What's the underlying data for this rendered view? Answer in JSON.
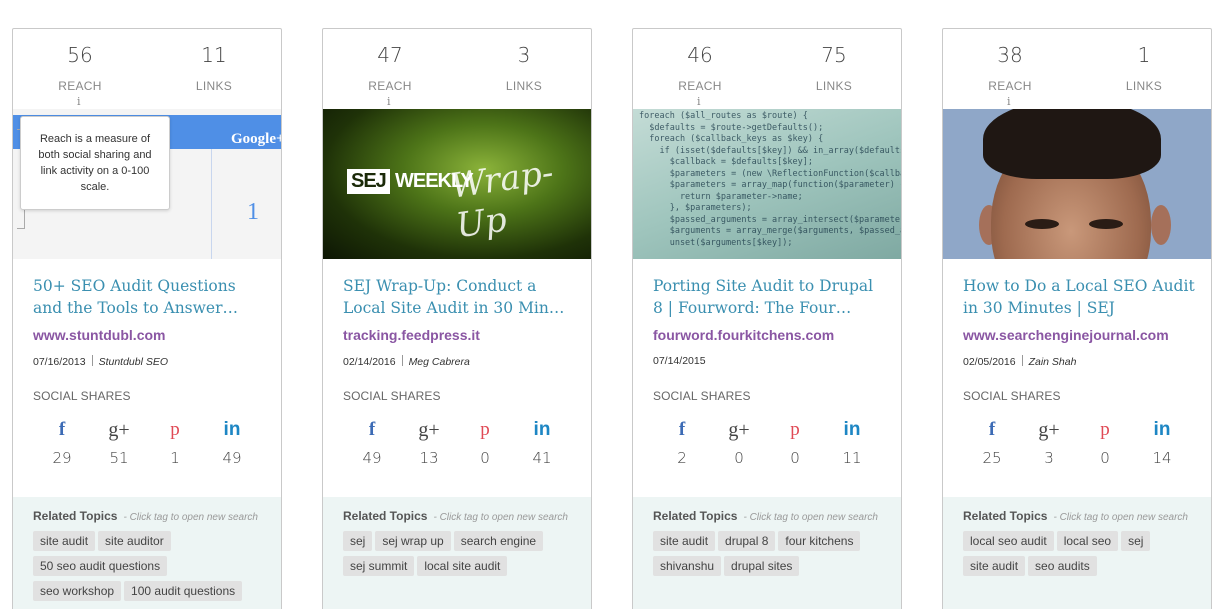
{
  "labels": {
    "reach": "REACH",
    "links": "LINKS",
    "social_shares": "SOCIAL SHARES",
    "related_topics": "Related Topics",
    "related_hint": "- Click tag to open new search",
    "info_icon": "i",
    "tooltip": "Reach is a measure of both social sharing and link activity on a 0-100 scale."
  },
  "thumb_text": {
    "google": "Google",
    "gplus": "+",
    "one": "1",
    "sej": "SEJ",
    "weekly": "WEEKLY",
    "wrap": "Wrap-Up",
    "code": "foreach ($all_routes as $route) {\n  $defaults = $route->getDefaults();\n  foreach ($callback_keys as $key) {\n    if (isset($defaults[$key]) && in_array($defaults\n      $callback = $defaults[$key];\n      $parameters = (new \\ReflectionFunction($callback\n      $parameters = array_map(function($parameter) {\n        return $parameter->name;\n      }, $parameters);\n      $passed_arguments = array_intersect($parameters, $a\n      $arguments = array_merge($arguments, $passed_arg\n      unset($arguments[$key]);"
  },
  "icons": {
    "facebook": "f",
    "googleplus": "g+",
    "pinterest": "p",
    "linkedin": "in"
  },
  "colors": {
    "title": "#3a8fb0",
    "domain": "#8a56a3",
    "facebook": "#3c6bb5",
    "pinterest": "#e04a55",
    "linkedin": "#1d86c4",
    "related_bg": "#edf5f4"
  },
  "cards": [
    {
      "reach": "56",
      "links": "11",
      "title": "50+ SEO Audit Questions and the Tools to Answer…",
      "domain": "www.stuntdubl.com",
      "date": "07/16/2013",
      "author": "Stuntdubl SEO",
      "shares": {
        "facebook": "29",
        "googleplus": "51",
        "pinterest": "1",
        "linkedin": "49"
      },
      "tags": [
        "site audit",
        "site auditor",
        "50 seo audit questions",
        "seo workshop",
        "100 audit questions"
      ]
    },
    {
      "reach": "47",
      "links": "3",
      "title": "SEJ Wrap-Up: Conduct a Local Site Audit in 30 Min…",
      "domain": "tracking.feedpress.it",
      "date": "02/14/2016",
      "author": "Meg Cabrera",
      "shares": {
        "facebook": "49",
        "googleplus": "13",
        "pinterest": "0",
        "linkedin": "41"
      },
      "tags": [
        "sej",
        "sej wrap up",
        "search engine",
        "sej summit",
        "local site audit"
      ]
    },
    {
      "reach": "46",
      "links": "75",
      "title": "Porting Site Audit to Drupal 8 | Fourword: The Four…",
      "domain": "fourword.fourkitchens.com",
      "date": "07/14/2015",
      "author": "",
      "shares": {
        "facebook": "2",
        "googleplus": "0",
        "pinterest": "0",
        "linkedin": "11"
      },
      "tags": [
        "site audit",
        "drupal 8",
        "four kitchens",
        "shivanshu",
        "drupal sites"
      ]
    },
    {
      "reach": "38",
      "links": "1",
      "title": "How to Do a Local SEO Audit in 30 Minutes | SEJ",
      "domain": "www.searchenginejournal.com",
      "date": "02/05/2016",
      "author": "Zain Shah",
      "shares": {
        "facebook": "25",
        "googleplus": "3",
        "pinterest": "0",
        "linkedin": "14"
      },
      "tags": [
        "local seo audit",
        "local seo",
        "sej",
        "site audit",
        "seo audits"
      ]
    }
  ]
}
